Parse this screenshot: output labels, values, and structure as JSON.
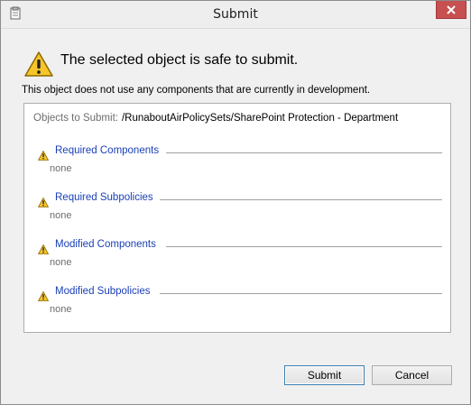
{
  "window": {
    "title": "Submit",
    "icon": "window-app-icon",
    "close_icon": "close-icon"
  },
  "header": {
    "icon": "warning-icon",
    "headline": "The selected object is safe to submit.",
    "subtext": "This object does not use any components that are currently in development."
  },
  "panel": {
    "objects_label": "Objects to Submit:",
    "objects_path": "/RunaboutAirPolicySets/SharePoint Protection - Department",
    "sections": [
      {
        "title": "Required Components",
        "value": "none",
        "icon": "warning-icon"
      },
      {
        "title": "Required Subpolicies",
        "value": "none",
        "icon": "warning-icon"
      },
      {
        "title": "Modified Components",
        "value": "none",
        "icon": "warning-icon"
      },
      {
        "title": "Modified Subpolicies",
        "value": "none",
        "icon": "warning-icon"
      }
    ]
  },
  "buttons": {
    "submit": "Submit",
    "cancel": "Cancel"
  },
  "colors": {
    "close_button": "#c75050",
    "section_title": "#1a3fb8",
    "warning_fill": "#f7c52a",
    "default_button_border": "#3c7fb1"
  }
}
